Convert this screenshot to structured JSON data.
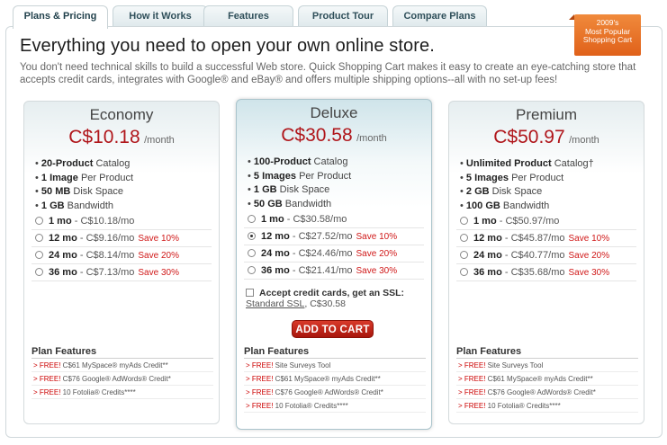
{
  "tabs": [
    {
      "label": "Plans & Pricing"
    },
    {
      "label": "How it Works"
    },
    {
      "label": "Features"
    },
    {
      "label": "Product Tour"
    },
    {
      "label": "Compare Plans"
    }
  ],
  "badge": {
    "line1": "2009's",
    "line2": "Most Popular",
    "line3": "Shopping Cart"
  },
  "headline": "Everything you need to open your own online store.",
  "intro": "You don't need technical skills to build a successful Web store. Quick Shopping Cart makes it easy to create an eye-catching store that accepts credit cards, integrates with Google® and eBay® and offers multiple shipping options--all with no set-up fees!",
  "per_month": "/month",
  "plans": [
    {
      "name": "Economy",
      "price": "C$10.18",
      "features": [
        {
          "b": "20-Product",
          "t": " Catalog"
        },
        {
          "b": "1 Image",
          "t": " Per Product"
        },
        {
          "b": "50 MB",
          "t": " Disk Space"
        },
        {
          "b": "1 GB",
          "t": " Bandwidth"
        }
      ],
      "terms": [
        {
          "term": "1 mo",
          "price": " - C$10.18/mo",
          "save": "",
          "checked": false
        },
        {
          "term": "12 mo",
          "price": " - C$9.16/mo",
          "save": "Save 10%",
          "checked": false
        },
        {
          "term": "24 mo",
          "price": " - C$8.14/mo",
          "save": "Save 20%",
          "checked": false
        },
        {
          "term": "36 mo",
          "price": " - C$7.13/mo",
          "save": "Save 30%",
          "checked": false
        }
      ],
      "plan_features": [
        {
          "free": "> FREE!",
          "t": " C$61 MySpace® myAds Credit**"
        },
        {
          "free": "> FREE!",
          "t": " C$76 Google® AdWords® Credit*"
        },
        {
          "free": "> FREE!",
          "t": " 10 Fotolia® Credits****"
        }
      ]
    },
    {
      "name": "Deluxe",
      "price": "C$30.58",
      "features": [
        {
          "b": "100-Product",
          "t": " Catalog"
        },
        {
          "b": "5 Images",
          "t": " Per Product"
        },
        {
          "b": "1 GB",
          "t": " Disk Space"
        },
        {
          "b": "50 GB",
          "t": " Bandwidth"
        }
      ],
      "terms": [
        {
          "term": "1 mo",
          "price": " - C$30.58/mo",
          "save": "",
          "checked": false
        },
        {
          "term": "12 mo",
          "price": " - C$27.52/mo",
          "save": "Save 10%",
          "checked": true
        },
        {
          "term": "24 mo",
          "price": " - C$24.46/mo",
          "save": "Save 20%",
          "checked": false
        },
        {
          "term": "36 mo",
          "price": " - C$21.41/mo",
          "save": "Save 30%",
          "checked": false
        }
      ],
      "ssl": {
        "label": "Accept credit cards, get an SSL:",
        "link": "Standard SSL",
        "price": ", C$30.58"
      },
      "add_to_cart": "ADD TO CART",
      "plan_features": [
        {
          "free": "> FREE!",
          "t": " Site Surveys Tool"
        },
        {
          "free": "> FREE!",
          "t": " C$61 MySpace® myAds Credit**"
        },
        {
          "free": "> FREE!",
          "t": " C$76 Google® AdWords® Credit*"
        },
        {
          "free": "> FREE!",
          "t": " 10 Fotolia® Credits****"
        }
      ]
    },
    {
      "name": "Premium",
      "price": "C$50.97",
      "features": [
        {
          "b": "Unlimited Product",
          "t": " Catalog†"
        },
        {
          "b": "5 Images",
          "t": " Per Product"
        },
        {
          "b": "2 GB",
          "t": " Disk Space"
        },
        {
          "b": "100 GB",
          "t": " Bandwidth"
        }
      ],
      "terms": [
        {
          "term": "1 mo",
          "price": " - C$50.97/mo",
          "save": "",
          "checked": false
        },
        {
          "term": "12 mo",
          "price": " - C$45.87/mo",
          "save": "Save 10%",
          "checked": false
        },
        {
          "term": "24 mo",
          "price": " - C$40.77/mo",
          "save": "Save 20%",
          "checked": false
        },
        {
          "term": "36 mo",
          "price": " - C$35.68/mo",
          "save": "Save 30%",
          "checked": false
        }
      ],
      "plan_features": [
        {
          "free": "> FREE!",
          "t": " Site Surveys Tool"
        },
        {
          "free": "> FREE!",
          "t": " C$61 MySpace® myAds Credit**"
        },
        {
          "free": "> FREE!",
          "t": " C$76 Google® AdWords® Credit*"
        },
        {
          "free": "> FREE!",
          "t": " 10 Fotolia® Credits****"
        }
      ]
    }
  ],
  "plan_features_title": "Plan Features"
}
